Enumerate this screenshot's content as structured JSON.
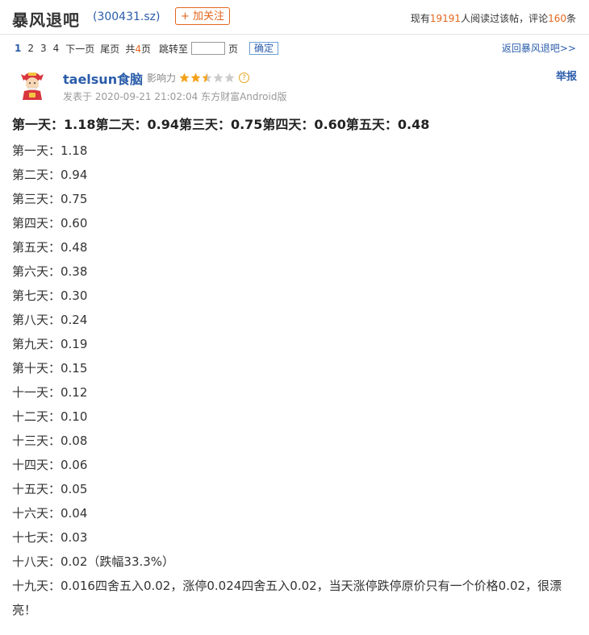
{
  "header": {
    "forum_title": "暴风退吧",
    "stock_code": "(300431.sz)",
    "follow_label": "+ 加关注",
    "stats_prefix": "现有",
    "readers": "19191",
    "stats_mid": "人阅读过该帖，评论",
    "comments": "160",
    "stats_suffix": "条"
  },
  "pager": {
    "pages": [
      "1",
      "2",
      "3",
      "4"
    ],
    "next_label": "下一页",
    "last_label": "尾页",
    "total_prefix": "共",
    "total_pages": "4",
    "total_suffix": "页",
    "jump_label": "跳转至",
    "jump_value": "",
    "page_unit": "页",
    "confirm_label": "确定",
    "back_link": "返回暴风退吧>>"
  },
  "post": {
    "username": "taelsun食脑",
    "influence_label": "影响力",
    "influence_stars": 2.5,
    "influence_max": 5,
    "help_icon": "?",
    "report_label": "举报",
    "meta": "发表于 2020-09-21 21:02:04 东方财富Android版",
    "title": "第一天：1.18第二天：0.94第三天：0.75第四天：0.60第五天：0.48",
    "lines": [
      "第一天：1.18",
      "第二天：0.94",
      "第三天：0.75",
      "第四天：0.60",
      "第五天：0.48",
      "第六天：0.38",
      "第七天：0.30",
      "第八天：0.24",
      "第九天：0.19",
      "第十天：0.15",
      "十一天：0.12",
      "十二天：0.10",
      "十三天：0.08",
      "十四天：0.06",
      "十五天：0.05",
      "十六天：0.04",
      "十七天：0.03",
      "十八天：0.02（跌幅33.3%）"
    ],
    "last_line": "十九天：0.016四舍五入0.02，涨停0.024四舍五入0.02，当天涨停跌停原价只有一个价格0.02，很漂亮！"
  },
  "colors": {
    "accent_blue": "#2a5caa",
    "accent_orange": "#e4651d",
    "star_on": "#f4a21b",
    "star_off": "#cccccc"
  }
}
